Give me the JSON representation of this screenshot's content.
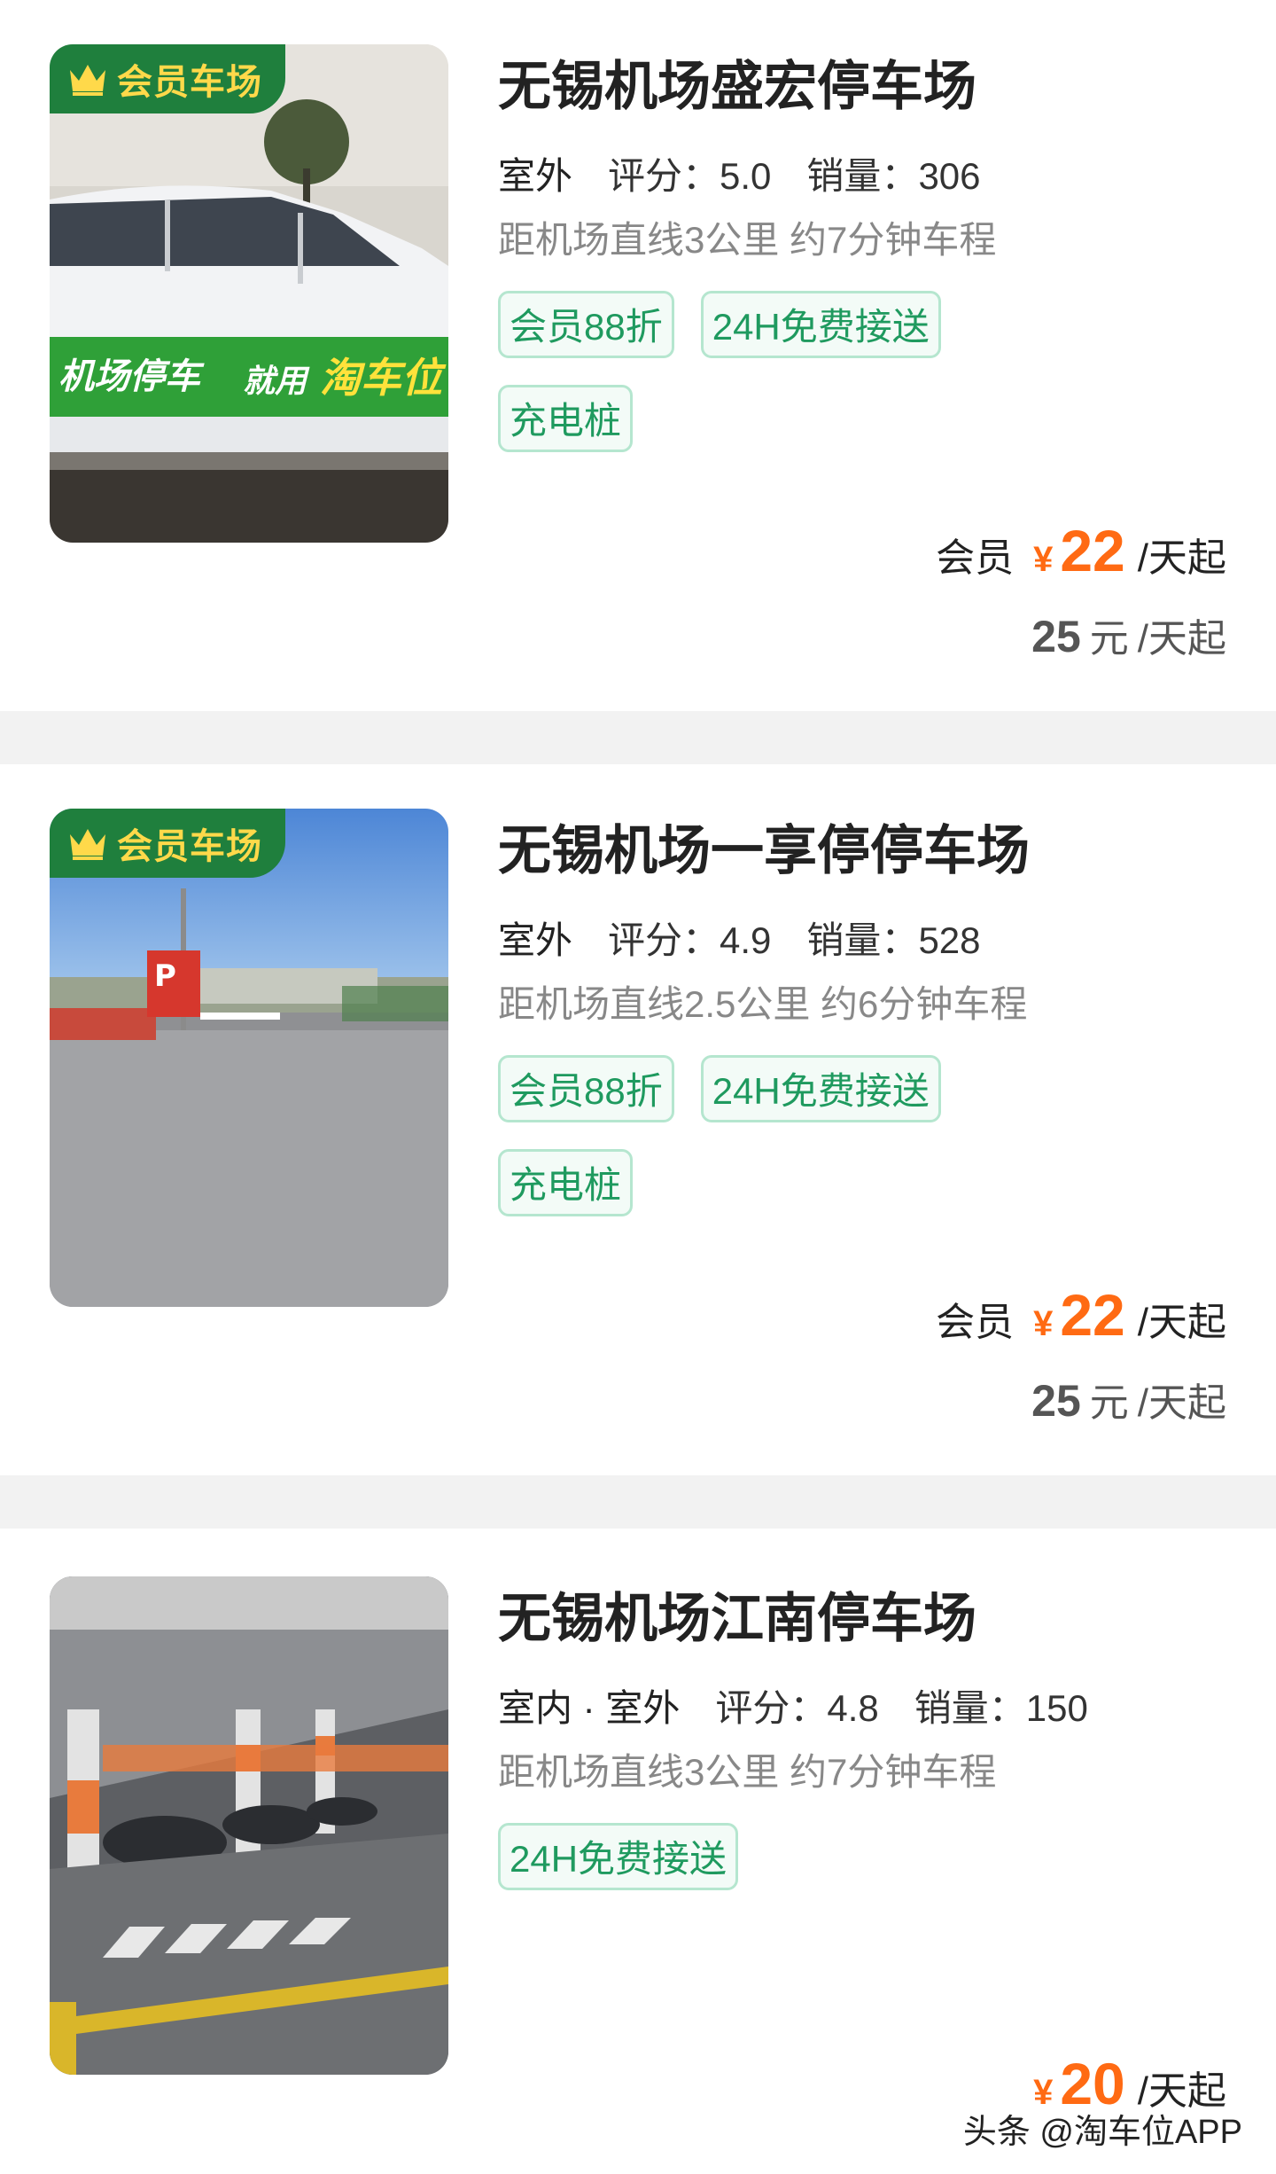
{
  "lots": [
    {
      "badge": "会员车场",
      "name": "无锡机场盛宏停车场",
      "environment": "室外",
      "rating_label": "评分：",
      "rating": "5.0",
      "sales_label": "销量：",
      "sales": "306",
      "distance": "距机场直线3公里 约7分钟车程",
      "tags": [
        "会员88折",
        "24H免费接送",
        "充电桩"
      ],
      "member_label": "会员",
      "currency": "¥",
      "price": "22",
      "unit": "/天起",
      "original_price": "25",
      "original_currency": "元",
      "original_unit": "/天起",
      "photo_banner": [
        "机场停车",
        "就用",
        "淘车位"
      ]
    },
    {
      "badge": "会员车场",
      "name": "无锡机场一享停停车场",
      "environment": "室外",
      "rating_label": "评分：",
      "rating": "4.9",
      "sales_label": "销量：",
      "sales": "528",
      "distance": "距机场直线2.5公里 约6分钟车程",
      "tags": [
        "会员88折",
        "24H免费接送",
        "充电桩"
      ],
      "member_label": "会员",
      "currency": "¥",
      "price": "22",
      "unit": "/天起",
      "original_price": "25",
      "original_currency": "元",
      "original_unit": "/天起",
      "photo_sign": "P"
    },
    {
      "name": "无锡机场江南停车场",
      "environment": "室内 · 室外",
      "rating_label": "评分：",
      "rating": "4.8",
      "sales_label": "销量：",
      "sales": "150",
      "distance": "距机场直线3公里 约7分钟车程",
      "tags": [
        "24H免费接送"
      ],
      "currency": "¥",
      "price": "20",
      "unit": "/天起"
    }
  ],
  "watermark": "头条 @淘车位APP",
  "colors": {
    "accent_price": "#ff6a13",
    "badge_bg": "#1f7f3d",
    "badge_text": "#ffd94a",
    "tag_text": "#1f9a5f",
    "tag_border": "#b5e6cf"
  }
}
